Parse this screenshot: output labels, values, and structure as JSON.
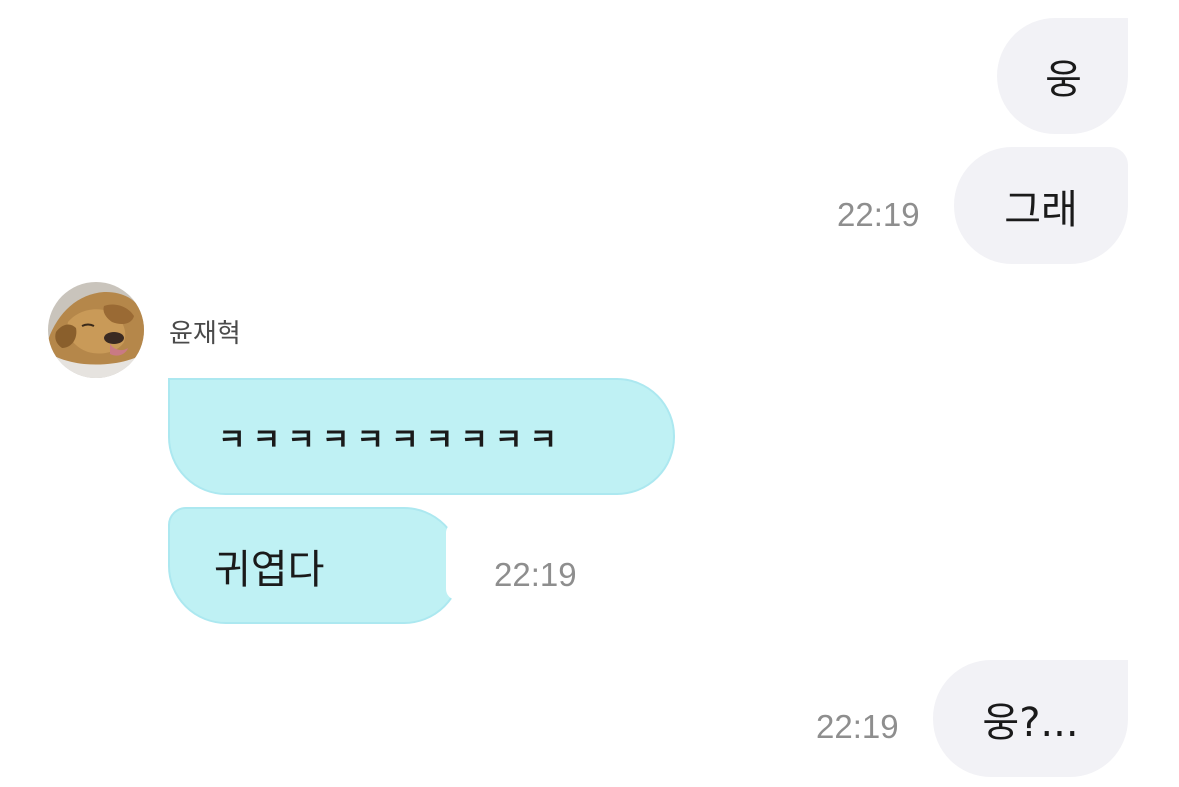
{
  "chat": {
    "messages": [
      {
        "direction": "outgoing",
        "text": "웅"
      },
      {
        "direction": "outgoing",
        "text": "그래",
        "time": "22:19"
      },
      {
        "direction": "incoming",
        "sender": "윤재혁",
        "avatar_icon": "golden-retriever-photo",
        "text": "ㅋㅋㅋㅋㅋㅋㅋㅋㅋㅋ"
      },
      {
        "direction": "incoming",
        "text": "귀엽다",
        "time": "22:19"
      },
      {
        "direction": "outgoing",
        "text": "웅?...",
        "time": "22:19"
      }
    ]
  },
  "colors": {
    "outgoing_bubble": "#f2f2f6",
    "incoming_bubble": "#bff1f4",
    "timestamp": "#8e8e8e"
  }
}
